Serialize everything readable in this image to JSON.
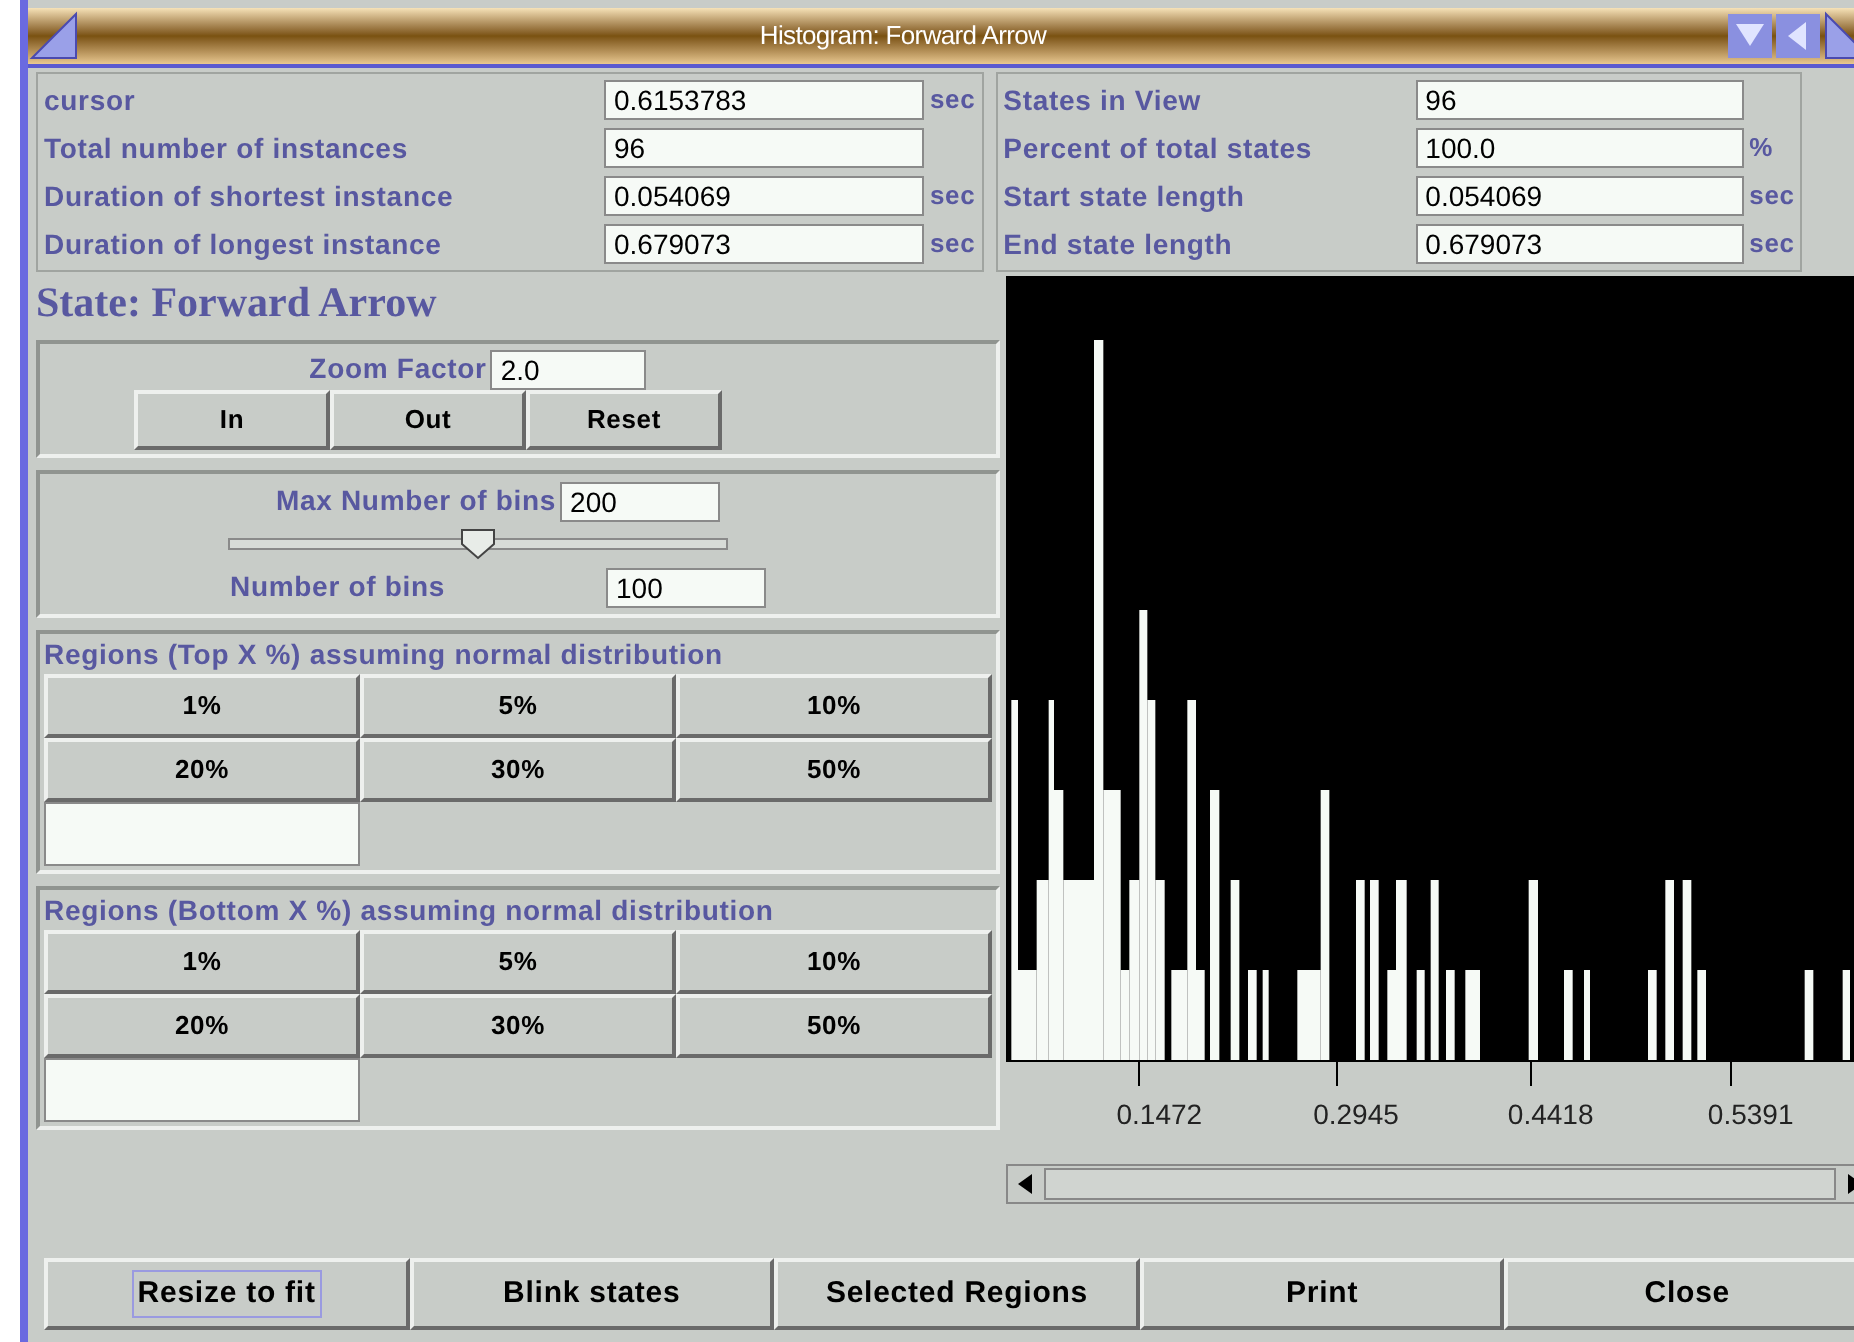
{
  "window": {
    "title": "Histogram: Forward Arrow"
  },
  "stats_left": [
    {
      "label": "cursor",
      "value": "0.6153783",
      "unit": "sec"
    },
    {
      "label": "Total number of instances",
      "value": "96"
    },
    {
      "label": "Duration of shortest instance",
      "value": "0.054069",
      "unit": "sec"
    },
    {
      "label": "Duration of longest instance",
      "value": "0.679073",
      "unit": "sec"
    }
  ],
  "stats_right": [
    {
      "label": "States in View",
      "value": "96"
    },
    {
      "label": "Percent of total states",
      "value": "100.0",
      "unit": "%"
    },
    {
      "label": "Start state length",
      "value": "0.054069",
      "unit": "sec"
    },
    {
      "label": "End state length",
      "value": "0.679073",
      "unit": "sec"
    }
  ],
  "state_title": "State: Forward Arrow",
  "zoom": {
    "label": "Zoom Factor",
    "value": "2.0",
    "buttons": [
      "In",
      "Out",
      "Reset"
    ]
  },
  "bins": {
    "max_label": "Max Number of bins",
    "max_value": "200",
    "level": 0.5,
    "count_label": "Number of bins",
    "count_value": "100"
  },
  "top_regions": {
    "title": "Regions (Top X %) assuming normal distribution",
    "buttons": [
      "1%",
      "5%",
      "10%",
      "20%",
      "30%",
      "50%"
    ]
  },
  "bottom_regions": {
    "title": "Regions (Bottom X %) assuming normal distribution",
    "buttons": [
      "1%",
      "5%",
      "10%",
      "20%",
      "30%",
      "50%"
    ]
  },
  "histogram": {
    "tick_labels": [
      "0.1472",
      "0.2945",
      "0.4418",
      "0.5391"
    ]
  },
  "buttons": [
    {
      "label": "Resize to fit",
      "focused": true
    },
    {
      "label": "Blink states",
      "focused": false
    },
    {
      "label": "Selected Regions",
      "focused": false
    },
    {
      "label": "Print",
      "focused": false
    },
    {
      "label": "Close",
      "focused": false
    }
  ]
}
